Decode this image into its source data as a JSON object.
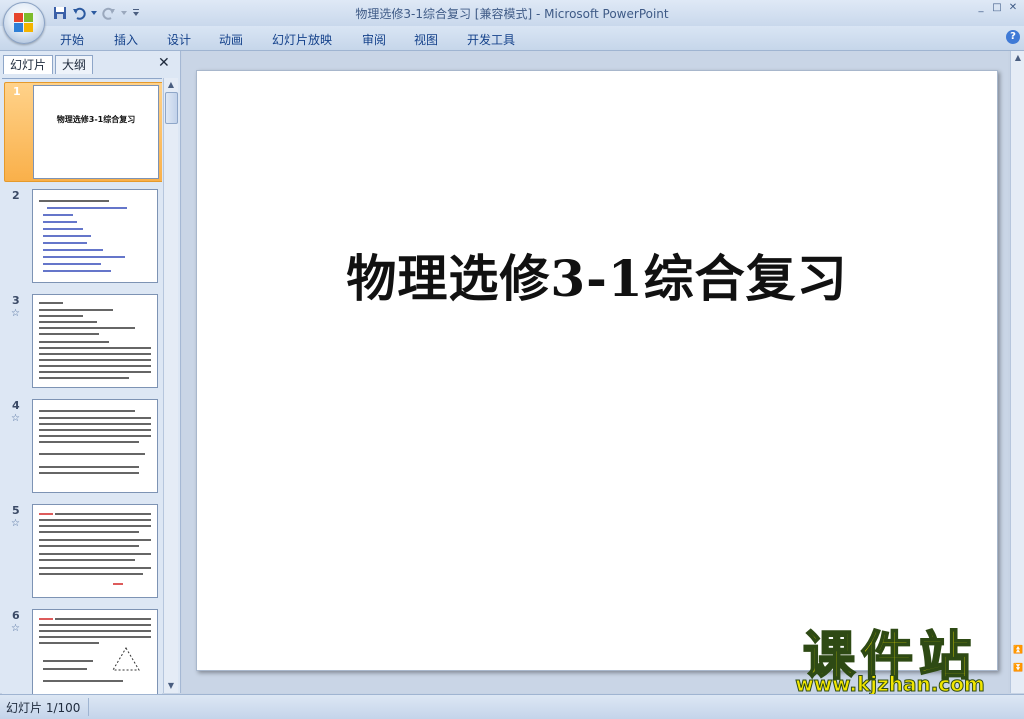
{
  "window": {
    "title": "物理选修3-1综合复习 [兼容模式] - Microsoft PowerPoint",
    "controls": {
      "minimize": "_",
      "restore": "□",
      "close": "✕"
    }
  },
  "ribbon": {
    "tabs": [
      "开始",
      "插入",
      "设计",
      "动画",
      "幻灯片放映",
      "审阅",
      "视图",
      "开发工具"
    ],
    "help": "?"
  },
  "panel": {
    "tabs": [
      "幻灯片",
      "大纲"
    ],
    "close": "✕",
    "thumbnails": [
      {
        "num": "1",
        "title": "物理选修3-1综合复习",
        "selected": true,
        "has_star": false
      },
      {
        "num": "2",
        "selected": false,
        "has_star": false
      },
      {
        "num": "3",
        "selected": false,
        "has_star": true
      },
      {
        "num": "4",
        "selected": false,
        "has_star": true
      },
      {
        "num": "5",
        "selected": false,
        "has_star": true
      },
      {
        "num": "6",
        "selected": false,
        "has_star": true
      }
    ],
    "star_glyph": "☆"
  },
  "slide": {
    "title": "物理选修3-1综合复习"
  },
  "status": {
    "slide_info": "幻灯片 1/100"
  },
  "watermark": {
    "title": "课件站",
    "url": "www.kjzhan.com"
  },
  "colors": {
    "accent": "#15428b",
    "selection": "#f9b04a",
    "watermark": "#f2e600"
  }
}
